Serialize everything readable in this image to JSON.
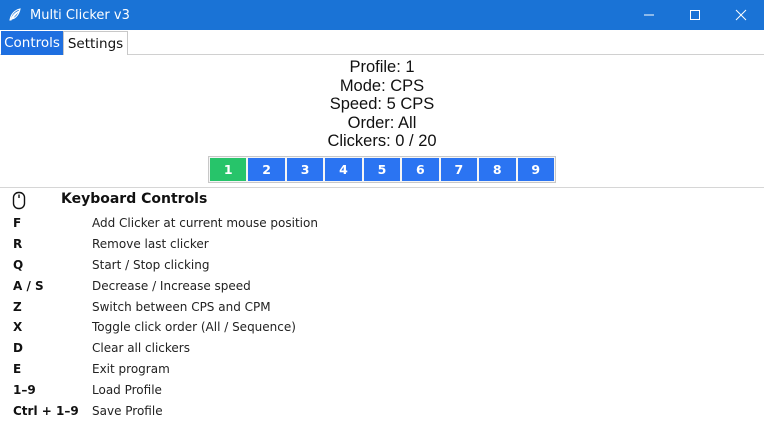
{
  "window": {
    "title": "Multi Clicker v3",
    "app_icon": "feather-icon",
    "title_bar_color": "#1a73d6"
  },
  "tabs": [
    {
      "label": "Controls",
      "active": true
    },
    {
      "label": "Settings",
      "active": false
    }
  ],
  "status": {
    "profile": "Profile: 1",
    "mode": "Mode: CPS",
    "speed": "Speed: 5 CPS",
    "order": "Order: All",
    "clickers": "Clickers: 0 / 20"
  },
  "profiles": {
    "buttons": [
      "1",
      "2",
      "3",
      "4",
      "5",
      "6",
      "7",
      "8",
      "9"
    ],
    "active": "1",
    "active_color": "#27c46a",
    "inactive_color": "#2b74f2"
  },
  "keyboard": {
    "icon": "mouse-icon",
    "title": "Keyboard Controls",
    "rows": [
      {
        "key": "F",
        "desc": "Add Clicker at current mouse position"
      },
      {
        "key": "R",
        "desc": "Remove last clicker"
      },
      {
        "key": "Q",
        "desc": "Start / Stop clicking"
      },
      {
        "key": "A / S",
        "desc": "Decrease / Increase speed"
      },
      {
        "key": "Z",
        "desc": "Switch between CPS and CPM"
      },
      {
        "key": "X",
        "desc": "Toggle click order (All / Sequence)"
      },
      {
        "key": "D",
        "desc": "Clear all clickers"
      },
      {
        "key": "E",
        "desc": "Exit program"
      },
      {
        "key": "1–9",
        "desc": "Load Profile"
      },
      {
        "key": "Ctrl + 1–9",
        "desc": "Save Profile"
      }
    ]
  }
}
